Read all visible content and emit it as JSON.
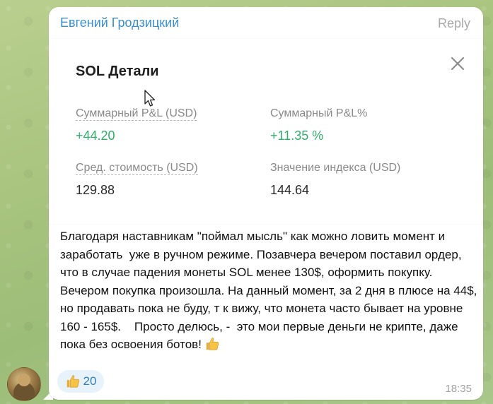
{
  "message": {
    "sender": "Евгений Гродзицкий",
    "reply_label": "Reply",
    "time": "18:35",
    "text": "Благодаря наставникам \"поймал мысль\" как можно ловить момент и заработать  уже в ручном режиме. Позавчера вечером поставил ордер, что в случае падения монеты SOL менее 130$, оформить покупку. Вечером покупка произошла. На данный момент, за 2 дня в плюсе на 44$, но продавать пока не буду, т к вижу, что монета часто бывает на уровне 160 - 165$.    Просто делюсь, -  это мои первые деньги не крипте, даже пока без освоения ботов!",
    "reaction_count": "20"
  },
  "card": {
    "title": "SOL Детали",
    "pnl_label": "Суммарный P&L (USD)",
    "pnl_value": "+44.20",
    "pnl_pct_label": "Суммарный P&L%",
    "pnl_pct_value": "+11.35 %",
    "avg_cost_label": "Сред. стоимость (USD)",
    "avg_cost_value": "129.88",
    "index_label": "Значение индекса (USD)",
    "index_value": "144.64"
  },
  "icons": {
    "close": "close-icon",
    "cursor": "mouse-cursor-icon",
    "thumbs_up": "thumbs-up-icon",
    "avatar": "avatar"
  },
  "colors": {
    "sender": "#3a8fd0",
    "positive": "#2fb06a",
    "reaction_bg": "#e8f2fb",
    "reaction_text": "#2f7fc0"
  }
}
